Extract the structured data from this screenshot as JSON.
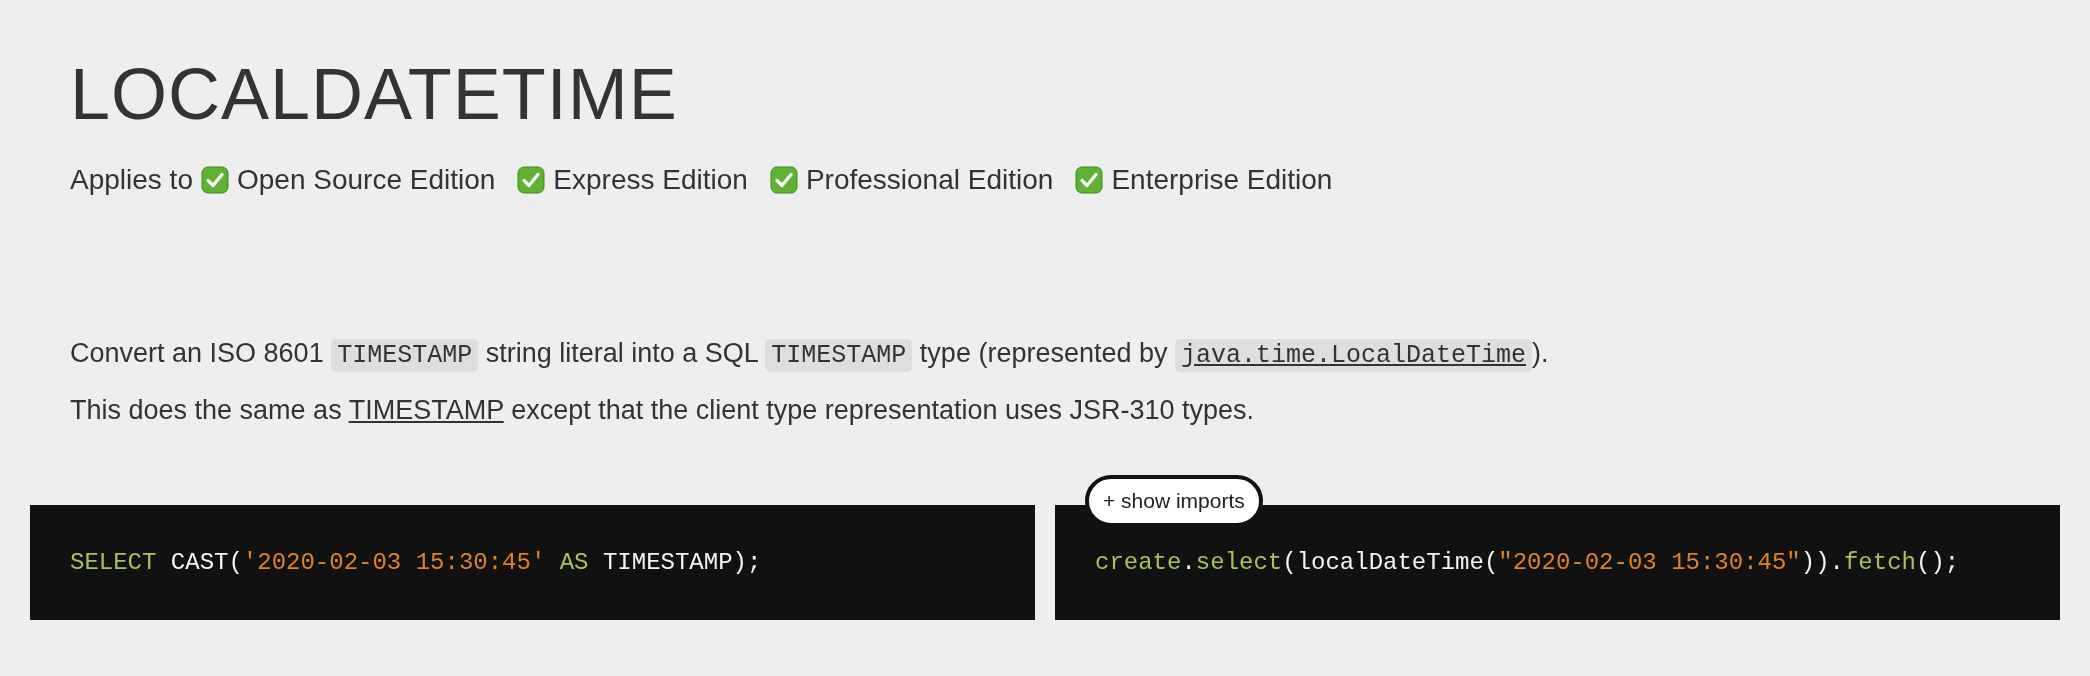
{
  "title": "LOCALDATETIME",
  "applies": {
    "label": "Applies to",
    "editions": [
      {
        "name": "Open Source Edition",
        "checked": true
      },
      {
        "name": "Express Edition",
        "checked": true
      },
      {
        "name": "Professional Edition",
        "checked": true
      },
      {
        "name": "Enterprise Edition",
        "checked": true
      }
    ]
  },
  "paragraphs": [
    [
      {
        "kind": "text",
        "text": "Convert an ISO 8601 "
      },
      {
        "kind": "code",
        "text": "TIMESTAMP"
      },
      {
        "kind": "text",
        "text": " string literal into a SQL "
      },
      {
        "kind": "code",
        "text": "TIMESTAMP"
      },
      {
        "kind": "text",
        "text": " type (represented by "
      },
      {
        "kind": "code-link",
        "text": "java.time.LocalDateTime"
      },
      {
        "kind": "text",
        "text": ")."
      }
    ],
    [
      {
        "kind": "text",
        "text": "This does the same as "
      },
      {
        "kind": "link",
        "text": "TIMESTAMP"
      },
      {
        "kind": "text",
        "text": " except that the client type representation uses JSR-310 types."
      }
    ]
  ],
  "code_blocks": [
    {
      "tokens": [
        {
          "kind": "keyword",
          "text": "SELECT"
        },
        {
          "kind": "plain",
          "text": " CAST("
        },
        {
          "kind": "string",
          "text": "'2020-02-03 15:30:45'"
        },
        {
          "kind": "keyword",
          "text": " AS"
        },
        {
          "kind": "plain",
          "text": " TIMESTAMP);"
        }
      ]
    },
    {
      "button": "+ show imports",
      "tokens": [
        {
          "kind": "keyword",
          "text": "create"
        },
        {
          "kind": "plain",
          "text": "."
        },
        {
          "kind": "keyword",
          "text": "select"
        },
        {
          "kind": "plain",
          "text": "(localDateTime("
        },
        {
          "kind": "string",
          "text": "\"2020-02-03 15:30:45\""
        },
        {
          "kind": "plain",
          "text": "))."
        },
        {
          "kind": "keyword",
          "text": "fetch"
        },
        {
          "kind": "plain",
          "text": "();"
        }
      ]
    }
  ]
}
